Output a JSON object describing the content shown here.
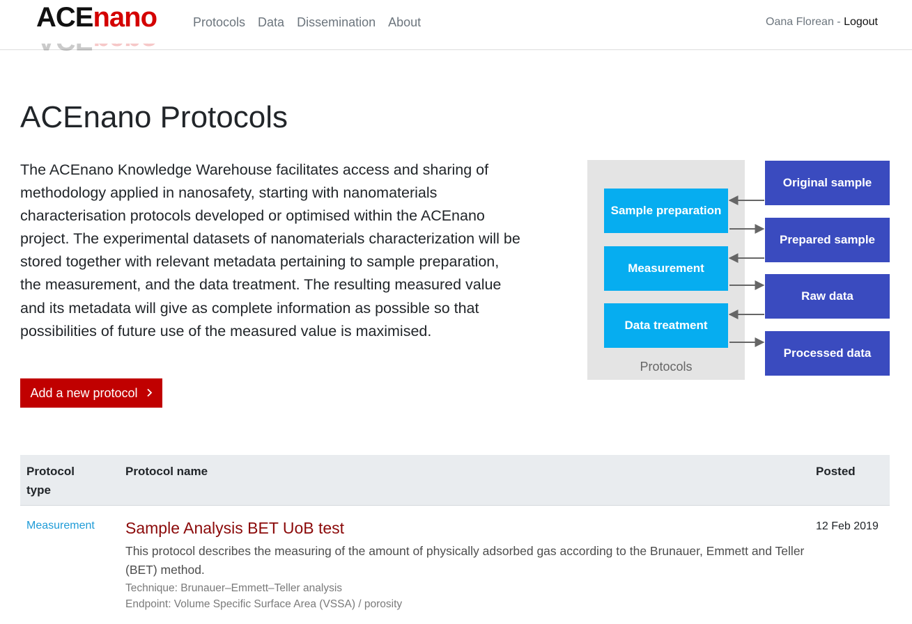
{
  "logo": {
    "part1": "ACE",
    "part2": "nano"
  },
  "nav": {
    "items": [
      {
        "label": "Protocols"
      },
      {
        "label": "Data"
      },
      {
        "label": "Dissemination"
      },
      {
        "label": "About"
      }
    ],
    "user": {
      "name": "Oana Florean",
      "separator": " - ",
      "logout_label": "Logout"
    }
  },
  "page": {
    "title": "ACEnano Protocols",
    "intro": "The ACEnano Knowledge Warehouse facilitates access and sharing of methodology applied in nanosafety, starting with nanomaterials characterisation protocols developed or optimised within the ACEnano project. The experimental datasets of nanomaterials characterization will be stored together with relevant metadata pertaining to sample preparation, the measurement, and the data treatment. The resulting measured value and its metadata will give as complete information as possible so that possibilities of future use of the measured value is maximised.",
    "add_button_label": "Add a new protocol",
    "add_button_icon": "chevron-right-icon"
  },
  "diagram": {
    "panel_label": "Protocols",
    "steps": [
      "Sample preparation",
      "Measurement",
      "Data treatment"
    ],
    "outputs": [
      "Original sample",
      "Prepared sample",
      "Raw data",
      "Processed data"
    ],
    "colors": {
      "panel": "#e4e4e4",
      "step": "#06adf0",
      "output": "#3a4bbf",
      "arrow": "#666666"
    }
  },
  "table": {
    "headers": {
      "type": "Protocol type",
      "name": "Protocol name",
      "posted": "Posted"
    },
    "rows": [
      {
        "type": "Measurement",
        "name": "Sample Analysis BET UoB test",
        "description": "This protocol describes the measuring of the amount of physically adsorbed gas according to the Brunauer, Emmett and Teller (BET) method.",
        "technique": "Technique: Brunauer–Emmett–Teller analysis",
        "endpoint": "Endpoint: Volume Specific Surface Area (VSSA) / porosity",
        "posted": "12 Feb 2019"
      }
    ]
  },
  "colors": {
    "brand_red": "#c00000",
    "link_blue": "#1e9bd7",
    "title_red": "#8b0a0a"
  }
}
